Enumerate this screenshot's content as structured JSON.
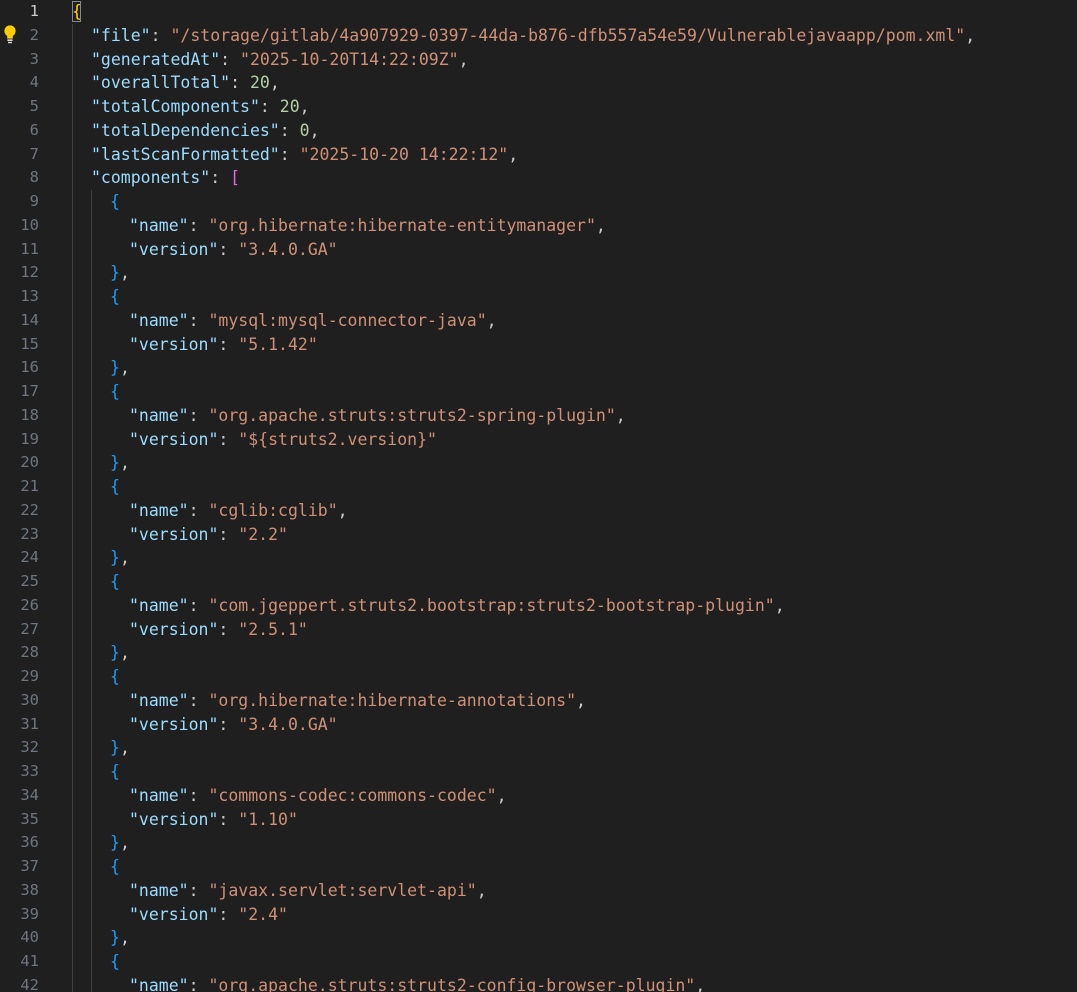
{
  "editor": {
    "active_line": 1,
    "lines": [
      [
        [
          "b1",
          "{"
        ]
      ],
      [
        [
          "key",
          "\"file\""
        ],
        [
          "pun",
          ": "
        ],
        [
          "str",
          "\"/storage/gitlab/4a907929-0397-44da-b876-dfb557a54e59/Vulnerablejavaapp/pom.xml\""
        ],
        [
          "pun",
          ","
        ]
      ],
      [
        [
          "key",
          "\"generatedAt\""
        ],
        [
          "pun",
          ": "
        ],
        [
          "str",
          "\"2025-10-20T14:22:09Z\""
        ],
        [
          "pun",
          ","
        ]
      ],
      [
        [
          "key",
          "\"overallTotal\""
        ],
        [
          "pun",
          ": "
        ],
        [
          "num",
          "20"
        ],
        [
          "pun",
          ","
        ]
      ],
      [
        [
          "key",
          "\"totalComponents\""
        ],
        [
          "pun",
          ": "
        ],
        [
          "num",
          "20"
        ],
        [
          "pun",
          ","
        ]
      ],
      [
        [
          "key",
          "\"totalDependencies\""
        ],
        [
          "pun",
          ": "
        ],
        [
          "num",
          "0"
        ],
        [
          "pun",
          ","
        ]
      ],
      [
        [
          "key",
          "\"lastScanFormatted\""
        ],
        [
          "pun",
          ": "
        ],
        [
          "str",
          "\"2025-10-20 14:22:12\""
        ],
        [
          "pun",
          ","
        ]
      ],
      [
        [
          "key",
          "\"components\""
        ],
        [
          "pun",
          ": "
        ],
        [
          "b2",
          "["
        ]
      ],
      [
        [
          "b3",
          "{"
        ]
      ],
      [
        [
          "key",
          "\"name\""
        ],
        [
          "pun",
          ": "
        ],
        [
          "str",
          "\"org.hibernate:hibernate-entitymanager\""
        ],
        [
          "pun",
          ","
        ]
      ],
      [
        [
          "key",
          "\"version\""
        ],
        [
          "pun",
          ": "
        ],
        [
          "str",
          "\"3.4.0.GA\""
        ]
      ],
      [
        [
          "b3",
          "}"
        ],
        [
          "pun",
          ","
        ]
      ],
      [
        [
          "b3",
          "{"
        ]
      ],
      [
        [
          "key",
          "\"name\""
        ],
        [
          "pun",
          ": "
        ],
        [
          "str",
          "\"mysql:mysql-connector-java\""
        ],
        [
          "pun",
          ","
        ]
      ],
      [
        [
          "key",
          "\"version\""
        ],
        [
          "pun",
          ": "
        ],
        [
          "str",
          "\"5.1.42\""
        ]
      ],
      [
        [
          "b3",
          "}"
        ],
        [
          "pun",
          ","
        ]
      ],
      [
        [
          "b3",
          "{"
        ]
      ],
      [
        [
          "key",
          "\"name\""
        ],
        [
          "pun",
          ": "
        ],
        [
          "str",
          "\"org.apache.struts:struts2-spring-plugin\""
        ],
        [
          "pun",
          ","
        ]
      ],
      [
        [
          "key",
          "\"version\""
        ],
        [
          "pun",
          ": "
        ],
        [
          "str",
          "\"${struts2.version}\""
        ]
      ],
      [
        [
          "b3",
          "}"
        ],
        [
          "pun",
          ","
        ]
      ],
      [
        [
          "b3",
          "{"
        ]
      ],
      [
        [
          "key",
          "\"name\""
        ],
        [
          "pun",
          ": "
        ],
        [
          "str",
          "\"cglib:cglib\""
        ],
        [
          "pun",
          ","
        ]
      ],
      [
        [
          "key",
          "\"version\""
        ],
        [
          "pun",
          ": "
        ],
        [
          "str",
          "\"2.2\""
        ]
      ],
      [
        [
          "b3",
          "}"
        ],
        [
          "pun",
          ","
        ]
      ],
      [
        [
          "b3",
          "{"
        ]
      ],
      [
        [
          "key",
          "\"name\""
        ],
        [
          "pun",
          ": "
        ],
        [
          "str",
          "\"com.jgeppert.struts2.bootstrap:struts2-bootstrap-plugin\""
        ],
        [
          "pun",
          ","
        ]
      ],
      [
        [
          "key",
          "\"version\""
        ],
        [
          "pun",
          ": "
        ],
        [
          "str",
          "\"2.5.1\""
        ]
      ],
      [
        [
          "b3",
          "}"
        ],
        [
          "pun",
          ","
        ]
      ],
      [
        [
          "b3",
          "{"
        ]
      ],
      [
        [
          "key",
          "\"name\""
        ],
        [
          "pun",
          ": "
        ],
        [
          "str",
          "\"org.hibernate:hibernate-annotations\""
        ],
        [
          "pun",
          ","
        ]
      ],
      [
        [
          "key",
          "\"version\""
        ],
        [
          "pun",
          ": "
        ],
        [
          "str",
          "\"3.4.0.GA\""
        ]
      ],
      [
        [
          "b3",
          "}"
        ],
        [
          "pun",
          ","
        ]
      ],
      [
        [
          "b3",
          "{"
        ]
      ],
      [
        [
          "key",
          "\"name\""
        ],
        [
          "pun",
          ": "
        ],
        [
          "str",
          "\"commons-codec:commons-codec\""
        ],
        [
          "pun",
          ","
        ]
      ],
      [
        [
          "key",
          "\"version\""
        ],
        [
          "pun",
          ": "
        ],
        [
          "str",
          "\"1.10\""
        ]
      ],
      [
        [
          "b3",
          "}"
        ],
        [
          "pun",
          ","
        ]
      ],
      [
        [
          "b3",
          "{"
        ]
      ],
      [
        [
          "key",
          "\"name\""
        ],
        [
          "pun",
          ": "
        ],
        [
          "str",
          "\"javax.servlet:servlet-api\""
        ],
        [
          "pun",
          ","
        ]
      ],
      [
        [
          "key",
          "\"version\""
        ],
        [
          "pun",
          ": "
        ],
        [
          "str",
          "\"2.4\""
        ]
      ],
      [
        [
          "b3",
          "}"
        ],
        [
          "pun",
          ","
        ]
      ],
      [
        [
          "b3",
          "{"
        ]
      ],
      [
        [
          "key",
          "\"name\""
        ],
        [
          "pun",
          ": "
        ],
        [
          "str",
          "\"org.apache.struts:struts2-config-browser-plugin\""
        ],
        [
          "pun",
          ","
        ]
      ]
    ]
  },
  "colors": {
    "background": "#1f1f1f",
    "key": "#9cdcfe",
    "string": "#ce9178",
    "number": "#b5cea8",
    "bracket_level1": "#ffd700",
    "bracket_level2": "#da70d6",
    "bracket_level3": "#179fff"
  },
  "icons": {
    "lightbulb": "lightbulb-icon"
  }
}
